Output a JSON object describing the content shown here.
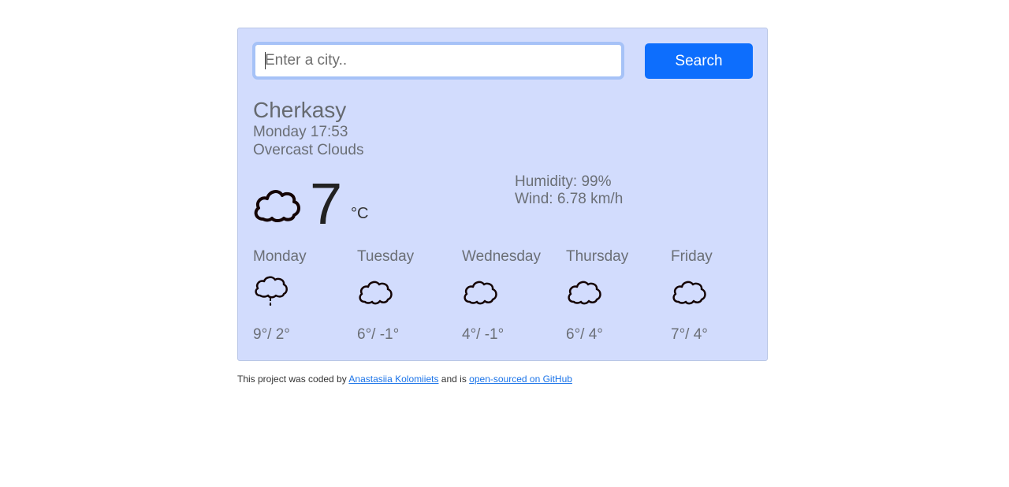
{
  "search": {
    "placeholder": "Enter a city..",
    "button_label": "Search"
  },
  "current": {
    "city": "Cherkasy",
    "datetime": "Monday 17:53",
    "description": "Overcast Clouds",
    "icon": "cloud-icon",
    "temperature": "7",
    "unit": "°C",
    "humidity": "Humidity: 99%",
    "wind": "Wind: 6.78 km/h"
  },
  "forecast": [
    {
      "day": "Monday",
      "icon": "rain-cloud-icon",
      "temps": "9°/ 2°"
    },
    {
      "day": "Tuesday",
      "icon": "cloud-icon",
      "temps": "6°/ -1°"
    },
    {
      "day": "Wednesday",
      "icon": "cloud-icon",
      "temps": "4°/ -1°"
    },
    {
      "day": "Thursday",
      "icon": "cloud-icon",
      "temps": "6°/ 4°"
    },
    {
      "day": "Friday",
      "icon": "cloud-icon",
      "temps": "7°/ 4°"
    }
  ],
  "footer": {
    "text_before": "This project was coded by ",
    "author_link": "Anastasiia Kolomiiets",
    "text_middle": " and is ",
    "github_link": "open-sourced on GitHub"
  },
  "colors": {
    "card_background": "#d2dcfd",
    "button": "#0d6efd",
    "link": "#1a73e8"
  }
}
